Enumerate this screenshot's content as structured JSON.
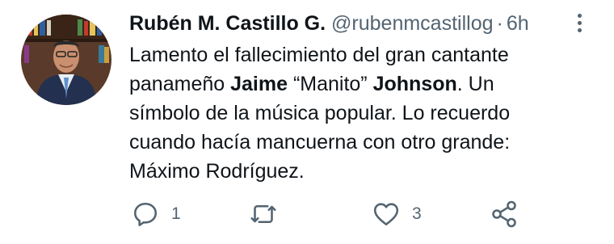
{
  "tweet": {
    "author_name": "Rubén M. Castillo G.",
    "handle": "@rubenmcastillog",
    "separator": "·",
    "time": "6h",
    "text": {
      "line1": "Lamento el fallecimiento del gran cantante",
      "l2_a": "panameño ",
      "l2_b": "Jaime",
      "l2_c": " “Manito” ",
      "l2_d": "Johnson",
      "l2_e": ". Un",
      "line3": "símbolo de la música popular. Lo recuerdo",
      "line4": "cuando hacía mancuerna con otro grande:",
      "line5": "Máximo Rodríguez."
    },
    "actions": {
      "reply": {
        "icon": "reply-icon",
        "count": "1"
      },
      "retweet": {
        "icon": "retweet-icon",
        "count": ""
      },
      "like": {
        "icon": "heart-icon",
        "count": "3"
      },
      "share": {
        "icon": "share-icon",
        "count": ""
      }
    }
  },
  "colors": {
    "text": "#0f1419",
    "secondary": "#536471",
    "background": "#ffffff"
  }
}
